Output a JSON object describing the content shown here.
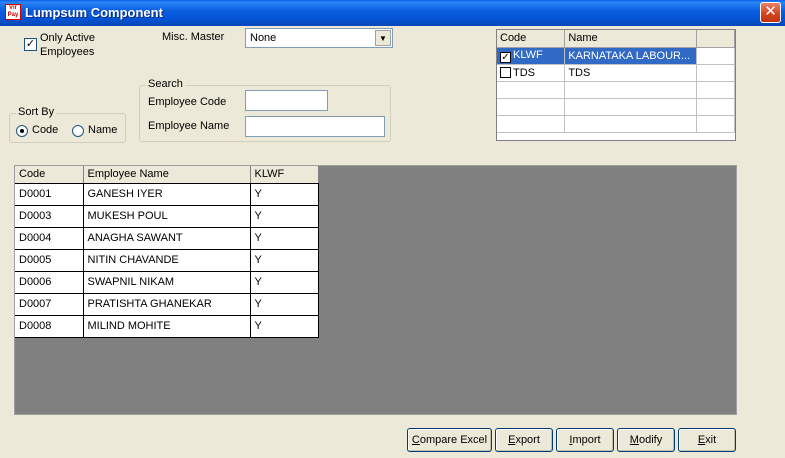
{
  "window": {
    "title": "Lumpsum Component",
    "close_glyph": "✕",
    "icon": "app-icon"
  },
  "filters": {
    "only_active_label_1": "Only Active",
    "only_active_label_2": "Employees",
    "only_active_checked": true,
    "misc_master_label": "Misc. Master",
    "misc_master_value": "None"
  },
  "sort_by": {
    "legend": "Sort By",
    "code_label": "Code",
    "name_label": "Name",
    "selected": "Code"
  },
  "search": {
    "legend": "Search",
    "employee_code_label": "Employee Code",
    "employee_name_label": "Employee Name",
    "employee_code_value": "",
    "employee_name_value": ""
  },
  "component_grid": {
    "headers": [
      "Code",
      "Name"
    ],
    "rows": [
      {
        "code": "KLWF",
        "name": "KARNATAKA LABOUR...",
        "checked": true
      },
      {
        "code": "TDS",
        "name": "TDS",
        "checked": false
      }
    ]
  },
  "employee_grid": {
    "headers": [
      "Code",
      "Employee Name",
      "KLWF"
    ],
    "rows": [
      {
        "code": "D0001",
        "name": "GANESH IYER",
        "klwf": "Y"
      },
      {
        "code": "D0003",
        "name": "MUKESH POUL",
        "klwf": "Y"
      },
      {
        "code": "D0004",
        "name": "ANAGHA SAWANT",
        "klwf": "Y"
      },
      {
        "code": "D0005",
        "name": "NITIN CHAVANDE",
        "klwf": "Y"
      },
      {
        "code": "D0006",
        "name": "SWAPNIL NIKAM",
        "klwf": "Y"
      },
      {
        "code": "D0007",
        "name": "PRATISHTA GHANEKAR",
        "klwf": "Y"
      },
      {
        "code": "D0008",
        "name": "MILIND MOHITE",
        "klwf": "Y"
      }
    ]
  },
  "buttons": {
    "compare_excel_u": "C",
    "compare_excel_rest": "ompare Excel",
    "export_u": "E",
    "export_rest": "xport",
    "import_u": "I",
    "import_rest": "mport",
    "modify_u": "M",
    "modify_rest": "odify",
    "exit_u": "E",
    "exit_rest": "xit"
  },
  "colors": {
    "titlebar": "#0454d6",
    "selection": "#316ac5",
    "grid_background": "#808080"
  }
}
